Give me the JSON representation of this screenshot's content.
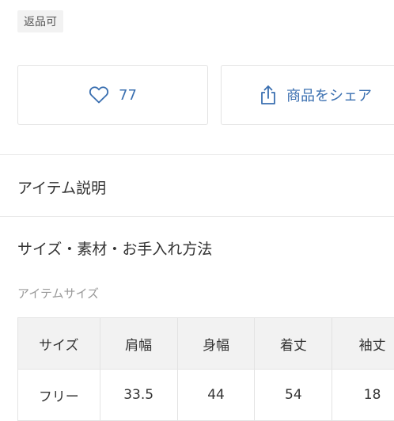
{
  "item": {
    "return_badge": "返品可"
  },
  "actions": {
    "like_count": "77",
    "like_icon": "heart-outline-icon",
    "share_label": "商品をシェア",
    "share_icon": "share-upload-icon",
    "accent_color": "#3a6fb0"
  },
  "sections": {
    "description_title": "アイテム説明",
    "size_material_title": "サイズ・素材・お手入れ方法"
  },
  "size_table": {
    "label": "アイテムサイズ",
    "headers": [
      "サイズ",
      "肩幅",
      "身幅",
      "着丈",
      "袖丈"
    ],
    "rows": [
      [
        "フリー",
        "33.5",
        "44",
        "54",
        "18"
      ]
    ]
  }
}
